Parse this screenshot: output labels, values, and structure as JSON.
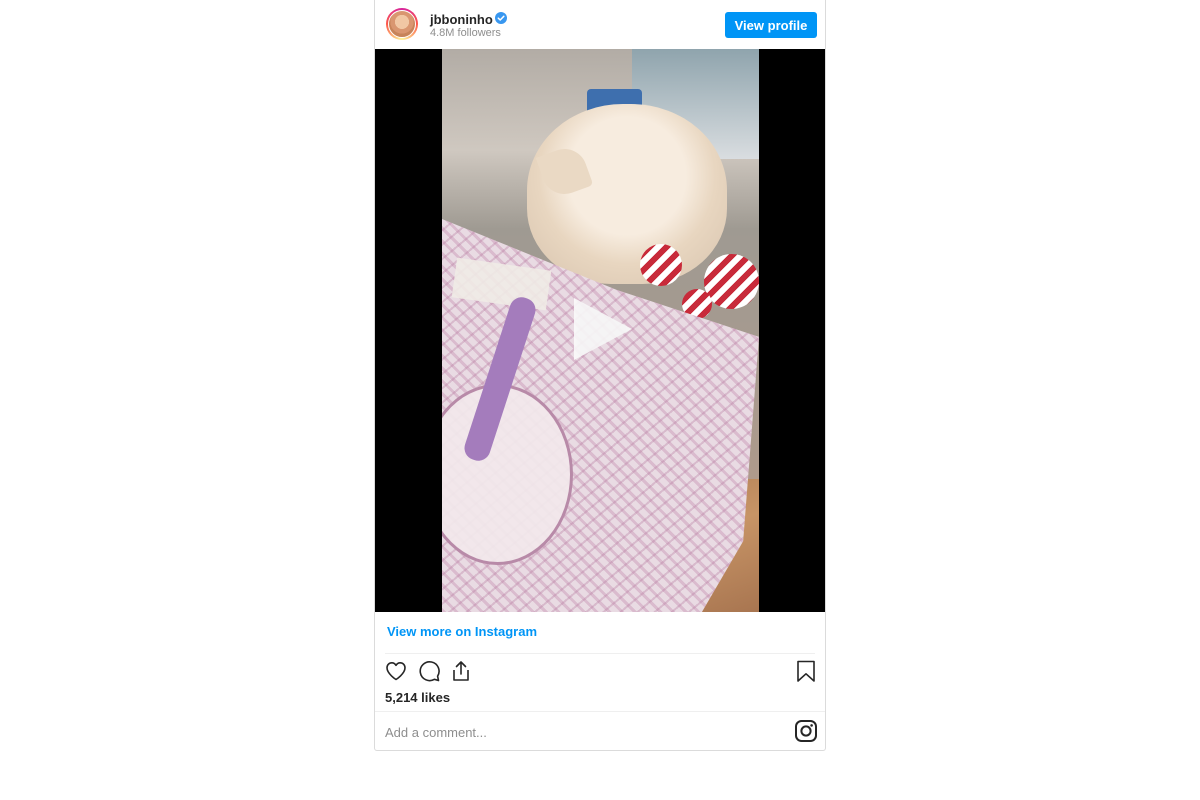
{
  "header": {
    "username": "jbboninho",
    "followers": "4.8M followers",
    "view_profile_label": "View profile"
  },
  "media": {
    "type": "video",
    "play_icon": "play-icon"
  },
  "footer": {
    "view_more_label": "View more on Instagram",
    "likes": "5,214 likes",
    "comment_placeholder": "Add a comment..."
  },
  "icons": [
    "verified-badge-icon",
    "heart-icon",
    "comment-icon",
    "share-icon",
    "bookmark-icon",
    "instagram-logo-icon"
  ],
  "colors": {
    "accent": "#0095f6",
    "text": "#262626",
    "muted": "#8e8e8e"
  }
}
